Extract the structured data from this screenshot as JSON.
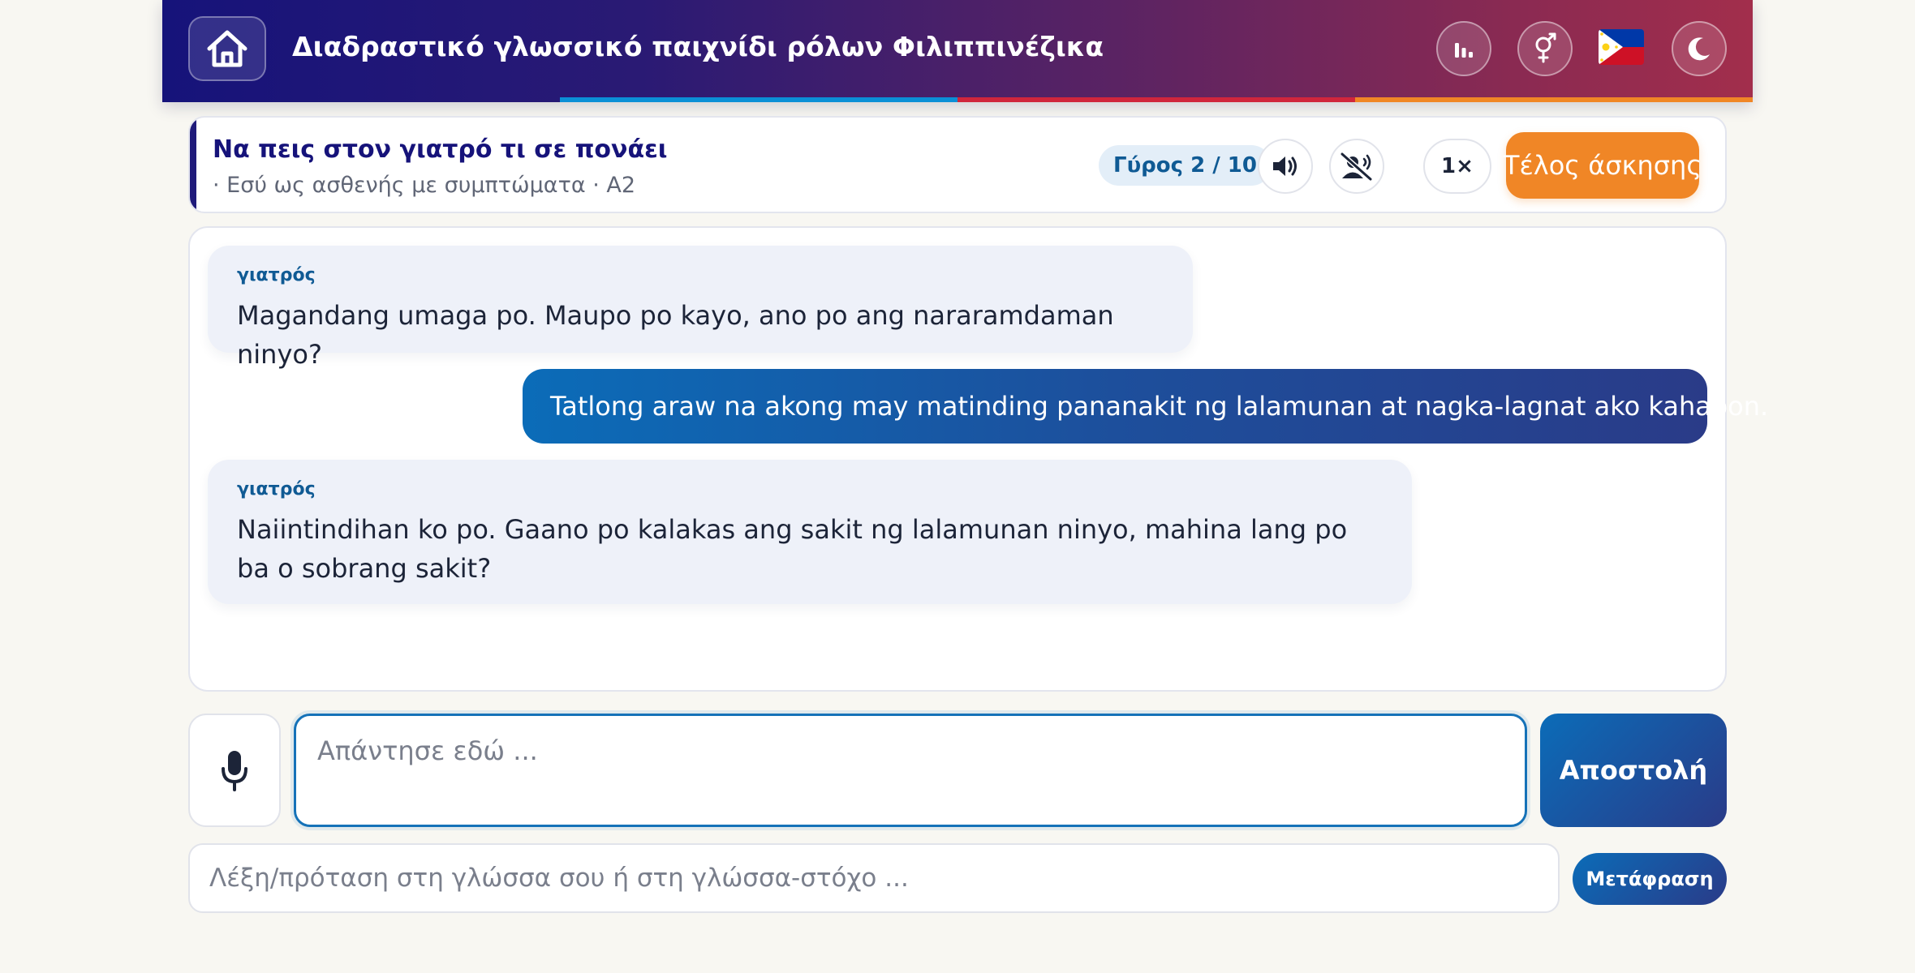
{
  "header": {
    "title": "Διαδραστικό γλωσσικό παιχνίδι ρόλων Φιλιππινέζικα",
    "home_icon": "home-icon",
    "stats_icon": "bar-chart-icon",
    "gender_icon": "gender-icon",
    "language_flag": "philippines-flag",
    "theme_icon": "moon-icon",
    "stripe_colors": [
      "#16137a",
      "#0b8fd6",
      "#d0263c",
      "#f08626"
    ],
    "gradient_colors": [
      "#16137a",
      "#a22e4c"
    ]
  },
  "scenario": {
    "title": "Να πεις στον γιατρό τι σε πονάει",
    "subtitle": "· Εσύ ως ασθενής με συμπτώματα · A2",
    "round_badge": "Γύρος 2 / 10",
    "audio_icon": "speaker-icon",
    "mute_icon": "speech-off-icon",
    "speed": "1×",
    "end_button": "Τέλος άσκησης"
  },
  "chat": {
    "messages": [
      {
        "role": "ai",
        "speaker": "γιατρός",
        "text": "Magandang umaga po. Maupo po kayo, ano po ang nararamdaman ninyo?"
      },
      {
        "role": "user",
        "text": "Tatlong araw na akong may matinding pananakit ng lalamunan at nagka-lagnat ako kahapon."
      },
      {
        "role": "ai",
        "speaker": "γιατρός",
        "text": "Naiintindihan ko po. Gaano po kalakas ang sakit ng lalamunan ninyo, mahina lang po ba o sobrang sakit?"
      }
    ]
  },
  "composer": {
    "mic_icon": "microphone-icon",
    "value": "",
    "placeholder": "Απάντησε εδώ ...",
    "send_button": "Αποστολή"
  },
  "translator": {
    "value": "",
    "placeholder": "Λέξη/πρόταση στη γλώσσα σου ή στη γλώσσα-στόχο ...",
    "button": "Μετάφραση"
  },
  "colors": {
    "accent": "#0b6cb8",
    "navy": "#16137a",
    "orange": "#f08626",
    "ai_bubble": "#eef1f9"
  }
}
